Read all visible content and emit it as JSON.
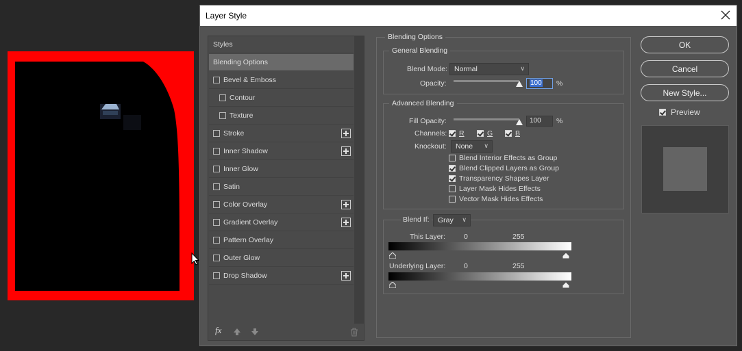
{
  "dialog": {
    "title": "Layer Style",
    "close_label": "close"
  },
  "styles": {
    "header": "Styles",
    "items": [
      {
        "label": "Blending Options",
        "checkbox": false,
        "plus": false,
        "selected": true,
        "indent": 0
      },
      {
        "label": "Bevel & Emboss",
        "checkbox": true,
        "plus": false,
        "indent": 0
      },
      {
        "label": "Contour",
        "checkbox": true,
        "plus": false,
        "indent": 1
      },
      {
        "label": "Texture",
        "checkbox": true,
        "plus": false,
        "indent": 1
      },
      {
        "label": "Stroke",
        "checkbox": true,
        "plus": true,
        "indent": 0
      },
      {
        "label": "Inner Shadow",
        "checkbox": true,
        "plus": true,
        "indent": 0
      },
      {
        "label": "Inner Glow",
        "checkbox": true,
        "plus": false,
        "indent": 0
      },
      {
        "label": "Satin",
        "checkbox": true,
        "plus": false,
        "indent": 0
      },
      {
        "label": "Color Overlay",
        "checkbox": true,
        "plus": true,
        "indent": 0
      },
      {
        "label": "Gradient Overlay",
        "checkbox": true,
        "plus": true,
        "indent": 0
      },
      {
        "label": "Pattern Overlay",
        "checkbox": true,
        "plus": false,
        "indent": 0
      },
      {
        "label": "Outer Glow",
        "checkbox": true,
        "plus": false,
        "indent": 0
      },
      {
        "label": "Drop Shadow",
        "checkbox": true,
        "plus": true,
        "indent": 0
      }
    ],
    "footer": {
      "fx": "fx"
    }
  },
  "blending": {
    "title": "Blending Options",
    "general": {
      "title": "General Blending",
      "blend_mode_label": "Blend Mode:",
      "blend_mode_value": "Normal",
      "opacity_label": "Opacity:",
      "opacity_value": "100",
      "opacity_unit": "%",
      "opacity_level": 1.0
    },
    "advanced": {
      "title": "Advanced Blending",
      "fill_label": "Fill Opacity:",
      "fill_value": "100",
      "fill_unit": "%",
      "fill_level": 1.0,
      "channels_label": "Channels:",
      "channel_r": "R",
      "channel_g": "G",
      "channel_b": "B",
      "knockout_label": "Knockout:",
      "knockout_value": "None",
      "options": [
        {
          "label": "Blend Interior Effects as Group",
          "checked": false
        },
        {
          "label": "Blend Clipped Layers as Group",
          "checked": true
        },
        {
          "label": "Transparency Shapes Layer",
          "checked": true
        },
        {
          "label": "Layer Mask Hides Effects",
          "checked": false
        },
        {
          "label": "Vector Mask Hides Effects",
          "checked": false
        }
      ]
    },
    "blend_if": {
      "label": "Blend If:",
      "value": "Gray",
      "this_layer_label": "This Layer:",
      "this_low": "0",
      "this_high": "255",
      "underlying_label": "Underlying Layer:",
      "under_low": "0",
      "under_high": "255"
    }
  },
  "buttons": {
    "ok": "OK",
    "cancel": "Cancel",
    "new_style": "New Style...",
    "preview_label": "Preview",
    "preview_checked": true
  },
  "colors": {
    "canvas_border": "#ff0000",
    "dialog_bg": "#535353",
    "accent": "#3b6fd0"
  }
}
